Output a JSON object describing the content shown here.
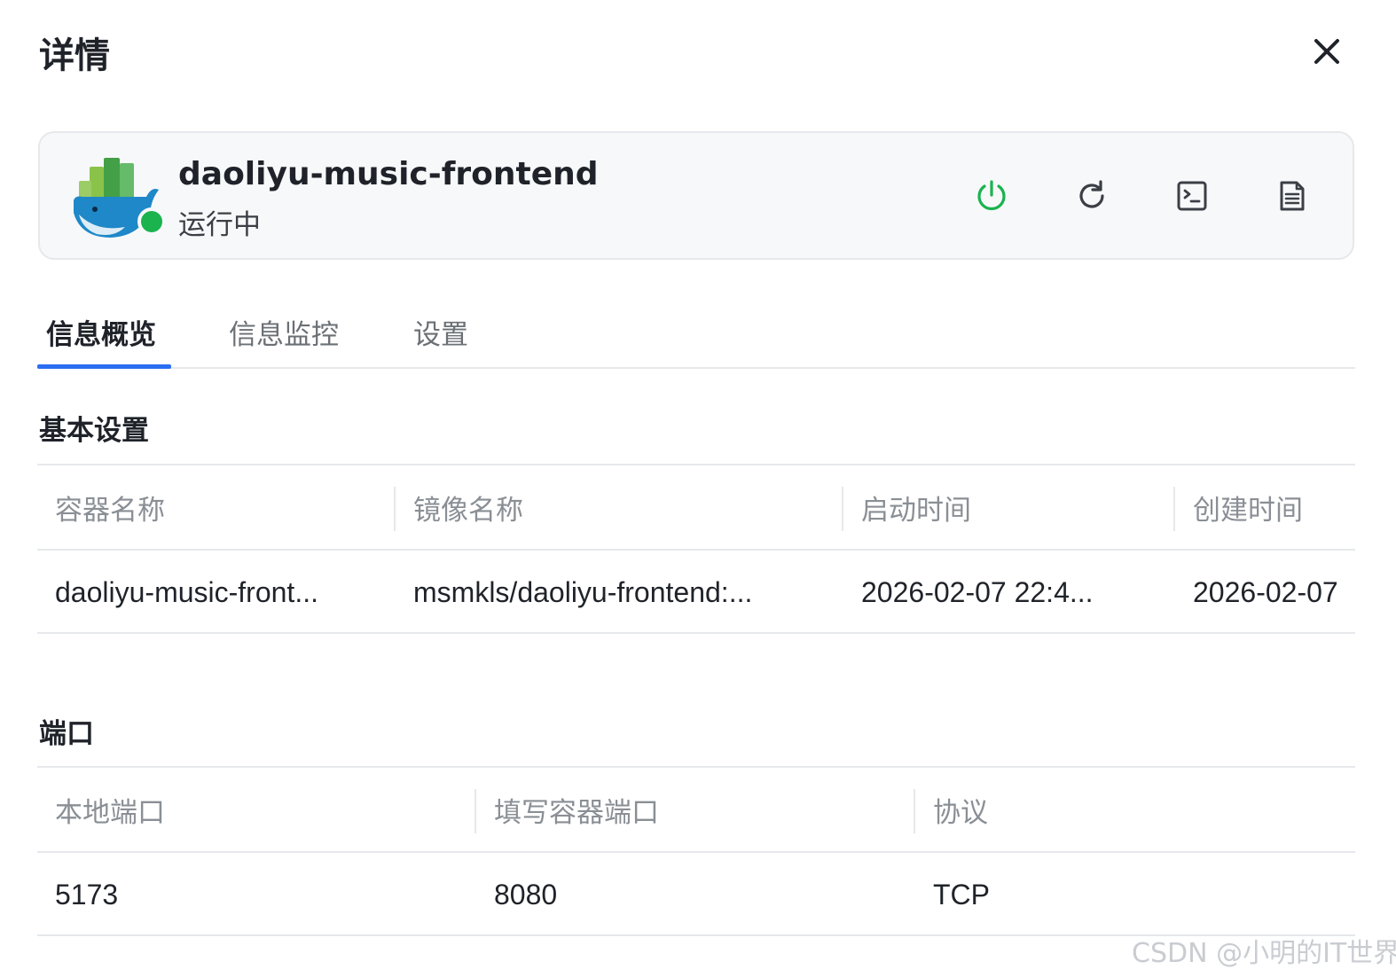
{
  "dialog": {
    "title": "详情"
  },
  "container": {
    "name": "daoliyu-music-frontend",
    "status": "运行中",
    "status_color": "#1ab34e",
    "icon": "docker-whale-icon",
    "actions": [
      {
        "icon": "power-icon",
        "color": "#1ab34e"
      },
      {
        "icon": "restart-icon",
        "color": "#3b3f45"
      },
      {
        "icon": "terminal-icon",
        "color": "#3b3f45"
      },
      {
        "icon": "log-document-icon",
        "color": "#3b3f45"
      }
    ]
  },
  "tabs": [
    {
      "label": "信息概览",
      "active": true
    },
    {
      "label": "信息监控",
      "active": false
    },
    {
      "label": "设置",
      "active": false
    }
  ],
  "accent_color": "#2a6ff2",
  "basic_settings": {
    "title": "基本设置",
    "headers": [
      "容器名称",
      "镜像名称",
      "启动时间",
      "创建时间"
    ],
    "row": [
      "daoliyu-music-front...",
      "msmkls/daoliyu-frontend:...",
      "2026-02-07 22:4...",
      "2026-02-07"
    ]
  },
  "ports": {
    "title": "端口",
    "headers": [
      "本地端口",
      "填写容器端口",
      "协议"
    ],
    "row": [
      "5173",
      "8080",
      "TCP"
    ]
  },
  "watermark": "CSDN @小明的IT世界"
}
